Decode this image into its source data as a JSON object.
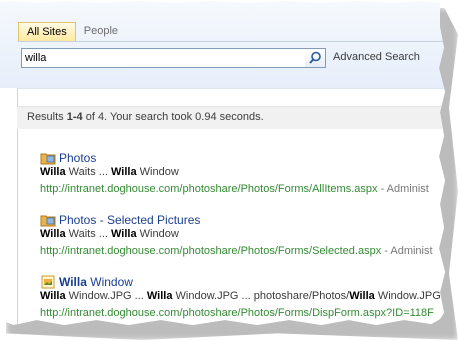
{
  "tabs": [
    {
      "label": "All Sites",
      "active": true
    },
    {
      "label": "People",
      "active": false
    }
  ],
  "search": {
    "value": "willa",
    "advanced_label": "Advanced Search"
  },
  "summary": {
    "prefix": "Results ",
    "range": "1-4",
    "middle": " of 4. Your search took 0.94 seconds."
  },
  "results": [
    {
      "icon": "folder-pictures-icon",
      "title_plain": "Photos",
      "snippet": [
        {
          "b": "Willa"
        },
        {
          "t": " Waits ... "
        },
        {
          "b": "Willa"
        },
        {
          "t": " Window"
        }
      ],
      "url": "http://intranet.doghouse.com/photoshare/Photos/Forms/AllItems.aspx",
      "author": " - Administ"
    },
    {
      "icon": "folder-pictures-icon",
      "title_plain": "Photos - Selected Pictures",
      "snippet": [
        {
          "b": "Willa"
        },
        {
          "t": " Waits ... "
        },
        {
          "b": "Willa"
        },
        {
          "t": " Window"
        }
      ],
      "url": "http://intranet.doghouse.com/photoshare/Photos/Forms/Selected.aspx",
      "author": " - Administ"
    },
    {
      "icon": "image-file-icon",
      "title_bold": "Willa",
      "title_rest": " Window",
      "snippet": [
        {
          "b": "Willa"
        },
        {
          "t": " Window.JPG ... "
        },
        {
          "b": "Willa"
        },
        {
          "t": " Window.JPG ... photoshare/Photos/"
        },
        {
          "b": "Willa"
        },
        {
          "t": " Window.JPG"
        }
      ],
      "url": "http://intranet.doghouse.com/photoshare/Photos/Forms/DispForm.aspx?ID=118F",
      "author": ""
    }
  ]
}
